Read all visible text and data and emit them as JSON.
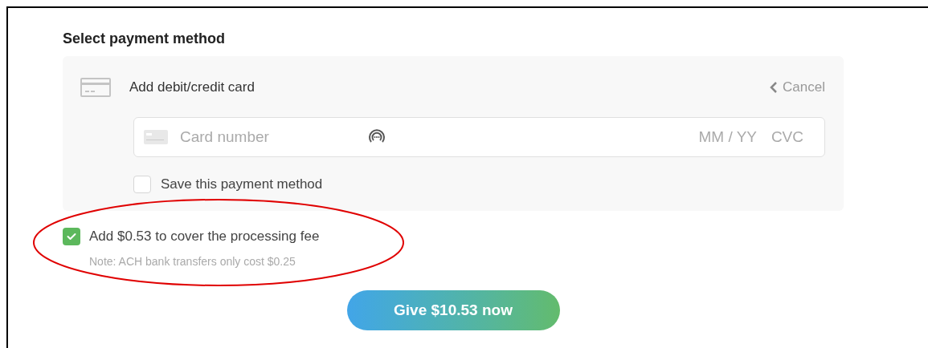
{
  "heading": "Select payment method",
  "card_panel": {
    "title": "Add debit/credit card",
    "cancel": "Cancel",
    "card_number": {
      "placeholder": "Card number"
    },
    "expiry": {
      "placeholder": "MM / YY"
    },
    "cvc": {
      "placeholder": "CVC"
    },
    "save_option": {
      "label": "Save this payment method",
      "checked": false
    }
  },
  "fee_option": {
    "label": "Add $0.53 to cover the processing fee",
    "checked": true,
    "note": "Note: ACH bank transfers only cost $0.25"
  },
  "submit_button": "Give $10.53 now"
}
